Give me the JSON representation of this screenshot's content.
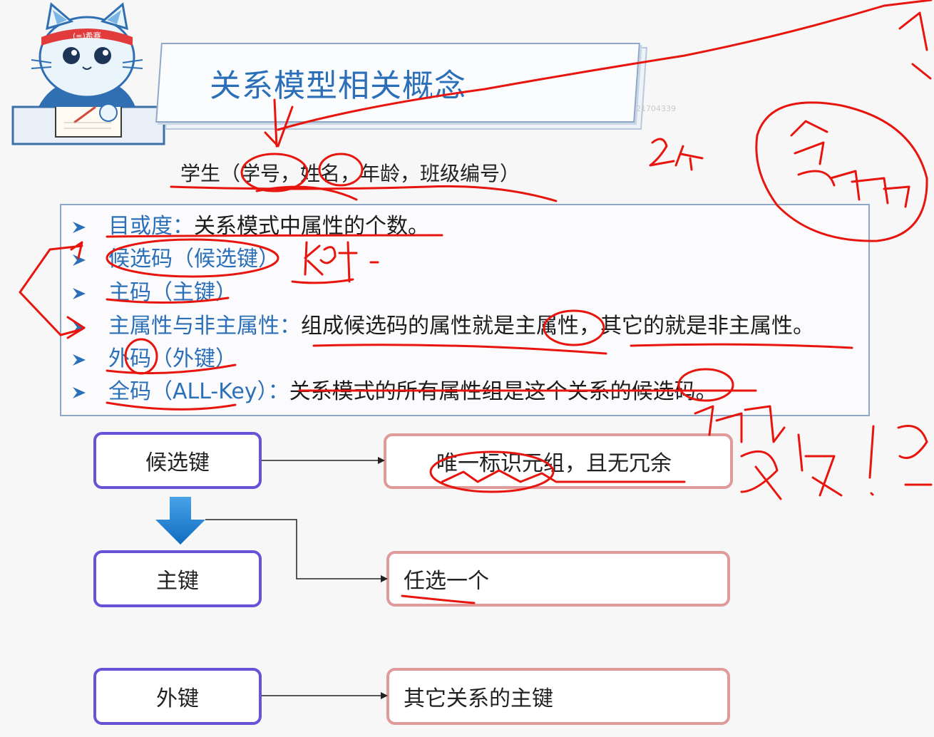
{
  "slide": {
    "title": "关系模型相关概念",
    "watermark": "21704339",
    "schema_text": "学生（学号，姓名，年龄，班级编号）",
    "mascot": {
      "headband_text": "(=)希赛"
    }
  },
  "concepts": [
    {
      "term": "目或度：",
      "desc": "关系模式中属性的个数。"
    },
    {
      "term": "候选码（候选键）",
      "desc": ""
    },
    {
      "term": "主码（主键）",
      "desc": ""
    },
    {
      "term": "主属性与非主属性：",
      "desc": "组成候选码的属性就是主属性，其它的就是非主属性。"
    },
    {
      "term": "外码（外键）",
      "desc": ""
    },
    {
      "term": "全码（ALL-Key）：",
      "desc": "关系模式的所有属性组是这个关系的候选码。"
    }
  ],
  "diagram": {
    "candidate_key": "候选键",
    "candidate_desc": "唯一标识元组，且无冗余",
    "primary_key": "主键",
    "primary_desc": "任选一个",
    "foreign_key": "外键",
    "foreign_desc": "其它关系的主键"
  },
  "colors": {
    "title_blue": "#2a6fb8",
    "term_blue": "#2a6fb8",
    "key_border": "#6653d6",
    "desc_border": "#e09a9a",
    "annotation_red": "#e8150e",
    "down_arrow": "#1f7fd0"
  }
}
